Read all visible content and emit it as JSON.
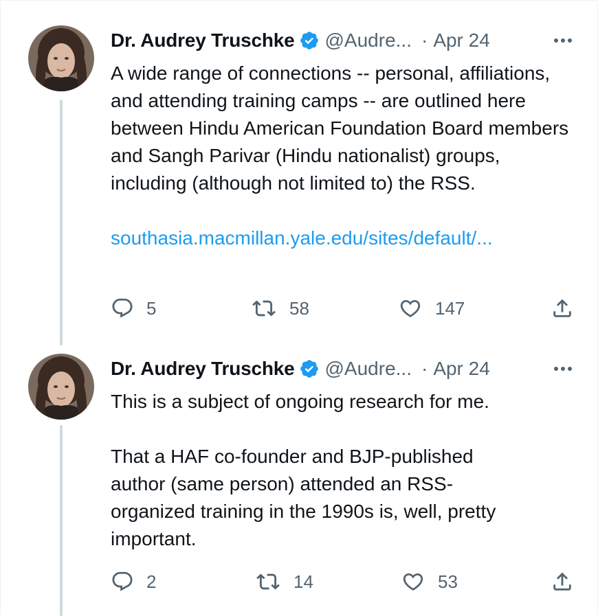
{
  "tweets": [
    {
      "author": {
        "name": "Dr. Audrey Truschke",
        "handle": "@Audre...",
        "verified": true,
        "avatar_icon": "user-avatar"
      },
      "separator": "·",
      "date": "Apr 24",
      "paragraphs": [
        "A wide range of connections -- personal, affiliations, and attending training camps -- are outlined here between Hindu American Foundation Board members and Sangh Parivar (Hindu nationalist) groups, including (although not limited to) the RSS."
      ],
      "link": "southasia.macmillan.yale.edu/sites/default/...",
      "stats": {
        "replies": "5",
        "retweets": "58",
        "likes": "147"
      }
    },
    {
      "author": {
        "name": "Dr. Audrey Truschke",
        "handle": "@Audre...",
        "verified": true,
        "avatar_icon": "user-avatar"
      },
      "separator": "·",
      "date": "Apr 24",
      "paragraphs": [
        "This is a subject of ongoing research for me.",
        "That a HAF co-founder and BJP-published author (same person) attended an RSS-organized training in the 1990s is, well, pretty important."
      ],
      "stats": {
        "replies": "2",
        "retweets": "14",
        "likes": "53"
      }
    }
  ],
  "colors": {
    "text": "#0f1419",
    "secondary": "#536471",
    "link": "#1d9bf0",
    "verified": "#1d9bf0",
    "thread_line": "#cfd9de"
  },
  "icons": [
    "more-icon",
    "verified-badge-icon",
    "reply-icon",
    "retweet-icon",
    "like-icon",
    "share-icon"
  ]
}
